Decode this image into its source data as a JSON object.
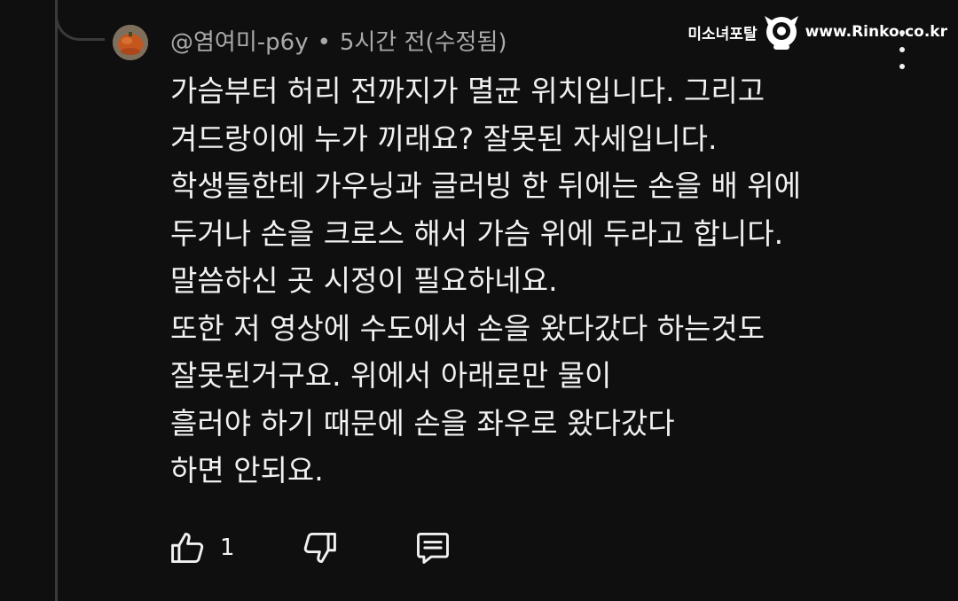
{
  "comment": {
    "author": "@염여미-p6y",
    "separator": "•",
    "timestamp": "5시간 전(수정됨)",
    "body_lines": [
      "가슴부터 허리 전까지가 멸균 위치입니다. 그리고",
      "겨드랑이에 누가 끼래요? 잘못된 자세입니다.",
      "학생들한테 가우닝과 글러빙 한 뒤에는 손을 배 위에",
      "두거나 손을 크로스 해서 가슴 위에 두라고 합니다.",
      "말씀하신 곳 시정이 필요하네요.",
      "또한 저 영상에 수도에서 손을 왔다갔다 하는것도",
      "잘못된거구요. 위에서 아래로만 물이",
      "흘러야 하기 때문에 손을 좌우로 왔다갔다",
      "하면 안되요."
    ]
  },
  "actions": {
    "like_count": "1",
    "like_icon": "thumbs-up-icon",
    "dislike_icon": "thumbs-down-icon",
    "reply_icon": "comment-icon"
  },
  "watermark": {
    "left_text": "미소녀포탈",
    "right_text": "www.Rinko.co.kr"
  },
  "colors": {
    "background": "#0f0f0f",
    "text_primary": "#f1f1f1",
    "text_secondary": "#aaaaaa",
    "thread_line": "#3a3a3a"
  }
}
